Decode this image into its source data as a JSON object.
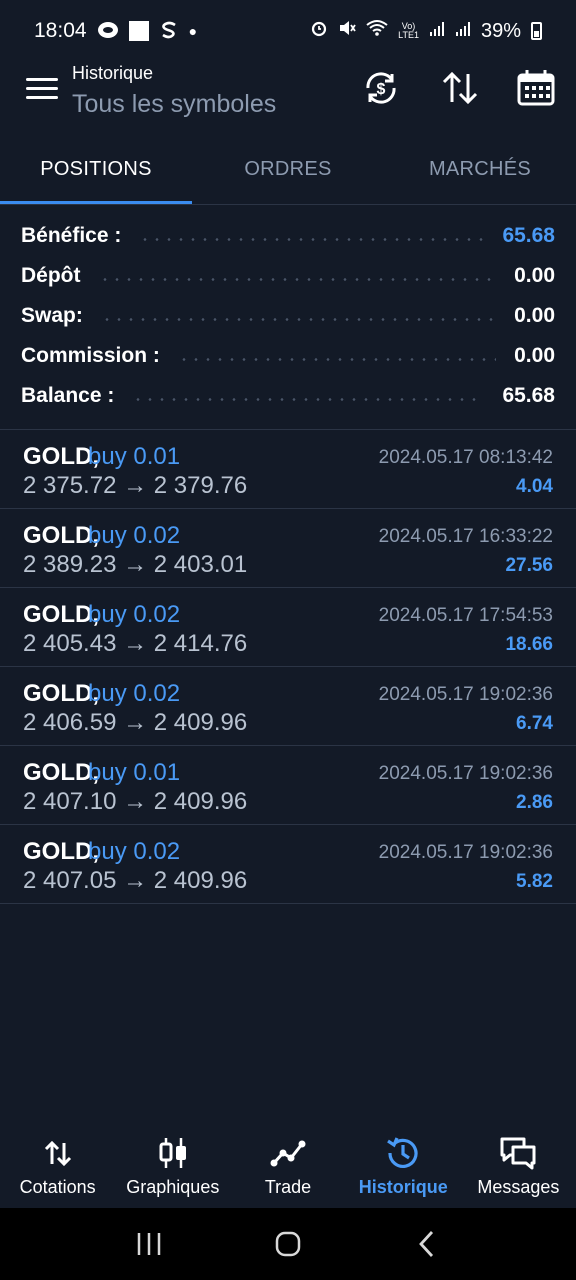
{
  "status_bar": {
    "time": "18:04",
    "battery": "39%",
    "icons": [
      "whatsapp-icon",
      "square-icon",
      "s-icon",
      "dot-icon",
      "alarm-icon",
      "mute-icon",
      "wifi-icon",
      "volte-icon",
      "signal-icon",
      "signal-2-icon",
      "battery-icon"
    ]
  },
  "header": {
    "title": "Historique",
    "subtitle": "Tous les symboles",
    "icons": [
      "menu-icon",
      "currency-sync-icon",
      "sort-icon",
      "calendar-icon"
    ]
  },
  "tabs": [
    {
      "label": "POSITIONS",
      "active": true
    },
    {
      "label": "ORDRES",
      "active": false
    },
    {
      "label": "MARCHÉS",
      "active": false
    }
  ],
  "summary": {
    "profit_label": "Bénéfice :",
    "profit_value": "65.68",
    "deposit_label": "Dépôt",
    "deposit_value": "0.00",
    "swap_label": "Swap:",
    "swap_value": "0.00",
    "commission_label": "Commission :",
    "commission_value": "0.00",
    "balance_label": "Balance :",
    "balance_value": "65.68"
  },
  "trades": [
    {
      "symbol": "GOLD,",
      "side": "buy 0.01",
      "prices": "2 375.72 → 2 379.76",
      "time": "2024.05.17 08:13:42",
      "profit": "4.04"
    },
    {
      "symbol": "GOLD,",
      "side": "buy 0.02",
      "prices": "2 389.23 → 2 403.01",
      "time": "2024.05.17 16:33:22",
      "profit": "27.56"
    },
    {
      "symbol": "GOLD,",
      "side": "buy 0.02",
      "prices": "2 405.43 → 2 414.76",
      "time": "2024.05.17 17:54:53",
      "profit": "18.66"
    },
    {
      "symbol": "GOLD,",
      "side": "buy 0.02",
      "prices": "2 406.59 → 2 409.96",
      "time": "2024.05.17 19:02:36",
      "profit": "6.74"
    },
    {
      "symbol": "GOLD,",
      "side": "buy 0.01",
      "prices": "2 407.10 → 2 409.96",
      "time": "2024.05.17 19:02:36",
      "profit": "2.86"
    },
    {
      "symbol": "GOLD,",
      "side": "buy 0.02",
      "prices": "2 407.05 → 2 409.96",
      "time": "2024.05.17 19:02:36",
      "profit": "5.82"
    }
  ],
  "bottom_nav": [
    {
      "label": "Cotations",
      "icon": "quotes-arrows-icon",
      "active": false
    },
    {
      "label": "Graphiques",
      "icon": "candlestick-icon",
      "active": false
    },
    {
      "label": "Trade",
      "icon": "trend-line-icon",
      "active": false
    },
    {
      "label": "Historique",
      "icon": "history-clock-icon",
      "active": true
    },
    {
      "label": "Messages",
      "icon": "chat-bubbles-icon",
      "active": false
    }
  ],
  "colors": {
    "background": "#131a27",
    "accent": "#4a9af5",
    "tab_indicator": "#3a8cf0",
    "muted_text": "#8d9bb0",
    "divider": "#2b3445"
  }
}
